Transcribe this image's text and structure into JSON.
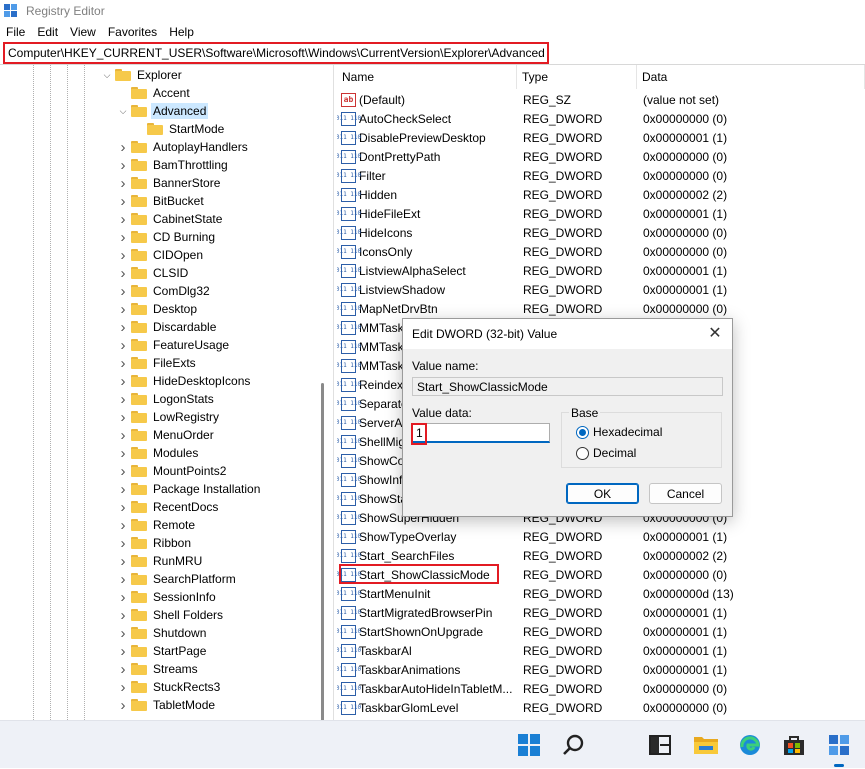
{
  "window": {
    "title": "Registry Editor"
  },
  "menu": [
    "File",
    "Edit",
    "View",
    "Favorites",
    "Help"
  ],
  "address": "Computer\\HKEY_CURRENT_USER\\Software\\Microsoft\\Windows\\CurrentVersion\\Explorer\\Advanced",
  "tree": [
    {
      "label": "Explorer",
      "level": 0,
      "expanded": true,
      "chevron": true
    },
    {
      "label": "Accent",
      "level": 1,
      "chevron": false
    },
    {
      "label": "Advanced",
      "level": 1,
      "expanded": true,
      "chevron": true,
      "selected": true
    },
    {
      "label": "StartMode",
      "level": 2,
      "chevron": false
    },
    {
      "label": "AutoplayHandlers",
      "level": 1,
      "chevron": true
    },
    {
      "label": "BamThrottling",
      "level": 1,
      "chevron": true
    },
    {
      "label": "BannerStore",
      "level": 1,
      "chevron": true
    },
    {
      "label": "BitBucket",
      "level": 1,
      "chevron": true
    },
    {
      "label": "CabinetState",
      "level": 1,
      "chevron": true
    },
    {
      "label": "CD Burning",
      "level": 1,
      "chevron": true
    },
    {
      "label": "CIDOpen",
      "level": 1,
      "chevron": true
    },
    {
      "label": "CLSID",
      "level": 1,
      "chevron": true
    },
    {
      "label": "ComDlg32",
      "level": 1,
      "chevron": true
    },
    {
      "label": "Desktop",
      "level": 1,
      "chevron": true
    },
    {
      "label": "Discardable",
      "level": 1,
      "chevron": true
    },
    {
      "label": "FeatureUsage",
      "level": 1,
      "chevron": true
    },
    {
      "label": "FileExts",
      "level": 1,
      "chevron": true
    },
    {
      "label": "HideDesktopIcons",
      "level": 1,
      "chevron": true
    },
    {
      "label": "LogonStats",
      "level": 1,
      "chevron": true
    },
    {
      "label": "LowRegistry",
      "level": 1,
      "chevron": true
    },
    {
      "label": "MenuOrder",
      "level": 1,
      "chevron": true
    },
    {
      "label": "Modules",
      "level": 1,
      "chevron": true
    },
    {
      "label": "MountPoints2",
      "level": 1,
      "chevron": true
    },
    {
      "label": "Package Installation",
      "level": 1,
      "chevron": true
    },
    {
      "label": "RecentDocs",
      "level": 1,
      "chevron": true
    },
    {
      "label": "Remote",
      "level": 1,
      "chevron": true
    },
    {
      "label": "Ribbon",
      "level": 1,
      "chevron": true
    },
    {
      "label": "RunMRU",
      "level": 1,
      "chevron": true
    },
    {
      "label": "SearchPlatform",
      "level": 1,
      "chevron": true
    },
    {
      "label": "SessionInfo",
      "level": 1,
      "chevron": true
    },
    {
      "label": "Shell Folders",
      "level": 1,
      "chevron": true
    },
    {
      "label": "Shutdown",
      "level": 1,
      "chevron": true
    },
    {
      "label": "StartPage",
      "level": 1,
      "chevron": true
    },
    {
      "label": "Streams",
      "level": 1,
      "chevron": true
    },
    {
      "label": "StuckRects3",
      "level": 1,
      "chevron": true
    },
    {
      "label": "TabletMode",
      "level": 1,
      "chevron": true
    }
  ],
  "list": {
    "headers": [
      "Name",
      "Type",
      "Data"
    ],
    "rows": [
      {
        "name": "(Default)",
        "type": "REG_SZ",
        "data": "(value not set)",
        "icon": "sz"
      },
      {
        "name": "AutoCheckSelect",
        "type": "REG_DWORD",
        "data": "0x00000000 (0)"
      },
      {
        "name": "DisablePreviewDesktop",
        "type": "REG_DWORD",
        "data": "0x00000001 (1)"
      },
      {
        "name": "DontPrettyPath",
        "type": "REG_DWORD",
        "data": "0x00000000 (0)"
      },
      {
        "name": "Filter",
        "type": "REG_DWORD",
        "data": "0x00000000 (0)"
      },
      {
        "name": "Hidden",
        "type": "REG_DWORD",
        "data": "0x00000002 (2)"
      },
      {
        "name": "HideFileExt",
        "type": "REG_DWORD",
        "data": "0x00000001 (1)"
      },
      {
        "name": "HideIcons",
        "type": "REG_DWORD",
        "data": "0x00000000 (0)"
      },
      {
        "name": "IconsOnly",
        "type": "REG_DWORD",
        "data": "0x00000000 (0)"
      },
      {
        "name": "ListviewAlphaSelect",
        "type": "REG_DWORD",
        "data": "0x00000001 (1)"
      },
      {
        "name": "ListviewShadow",
        "type": "REG_DWORD",
        "data": "0x00000001 (1)"
      },
      {
        "name": "MapNetDrvBtn",
        "type": "REG_DWORD",
        "data": "0x00000000 (0)"
      },
      {
        "name": "MMTask",
        "type": "",
        "data": ""
      },
      {
        "name": "MMTask",
        "type": "",
        "data": ""
      },
      {
        "name": "MMTask",
        "type": "",
        "data": ""
      },
      {
        "name": "Reindexed",
        "type": "",
        "data": ""
      },
      {
        "name": "Separate",
        "type": "",
        "data": ""
      },
      {
        "name": "ServerAd",
        "type": "",
        "data": ""
      },
      {
        "name": "ShellMig",
        "type": "",
        "data": ""
      },
      {
        "name": "ShowCo",
        "type": "",
        "data": ""
      },
      {
        "name": "ShowInf",
        "type": "",
        "data": ""
      },
      {
        "name": "ShowSta",
        "type": "",
        "data": ""
      },
      {
        "name": "ShowSuperHidden",
        "type": "REG_DWORD",
        "data": "0x00000000 (0)"
      },
      {
        "name": "ShowTypeOverlay",
        "type": "REG_DWORD",
        "data": "0x00000001 (1)"
      },
      {
        "name": "Start_SearchFiles",
        "type": "REG_DWORD",
        "data": "0x00000002 (2)"
      },
      {
        "name": "Start_ShowClassicMode",
        "type": "REG_DWORD",
        "data": "0x00000000 (0)",
        "highlight": true
      },
      {
        "name": "StartMenuInit",
        "type": "REG_DWORD",
        "data": "0x0000000d (13)"
      },
      {
        "name": "StartMigratedBrowserPin",
        "type": "REG_DWORD",
        "data": "0x00000001 (1)"
      },
      {
        "name": "StartShownOnUpgrade",
        "type": "REG_DWORD",
        "data": "0x00000001 (1)"
      },
      {
        "name": "TaskbarAl",
        "type": "REG_DWORD",
        "data": "0x00000001 (1)"
      },
      {
        "name": "TaskbarAnimations",
        "type": "REG_DWORD",
        "data": "0x00000001 (1)"
      },
      {
        "name": "TaskbarAutoHideInTabletM...",
        "type": "REG_DWORD",
        "data": "0x00000000 (0)"
      },
      {
        "name": "TaskbarGlomLevel",
        "type": "REG_DWORD",
        "data": "0x00000000 (0)"
      }
    ]
  },
  "dialog": {
    "title": "Edit DWORD (32-bit) Value",
    "value_name_label": "Value name:",
    "value_name": "Start_ShowClassicMode",
    "value_data_label": "Value data:",
    "value_data": "1",
    "base_label": "Base",
    "hex_label": "Hexadecimal",
    "dec_label": "Decimal",
    "ok_label": "OK",
    "cancel_label": "Cancel",
    "close_glyph": "✕"
  },
  "taskbar": [
    "start-icon",
    "search-icon",
    "task-view-icon",
    "file-explorer-icon",
    "edge-icon",
    "store-icon",
    "regedit-icon"
  ],
  "colors": {
    "highlight": "#e21b23",
    "accent": "#0067c0",
    "selection": "#cce8ff"
  }
}
